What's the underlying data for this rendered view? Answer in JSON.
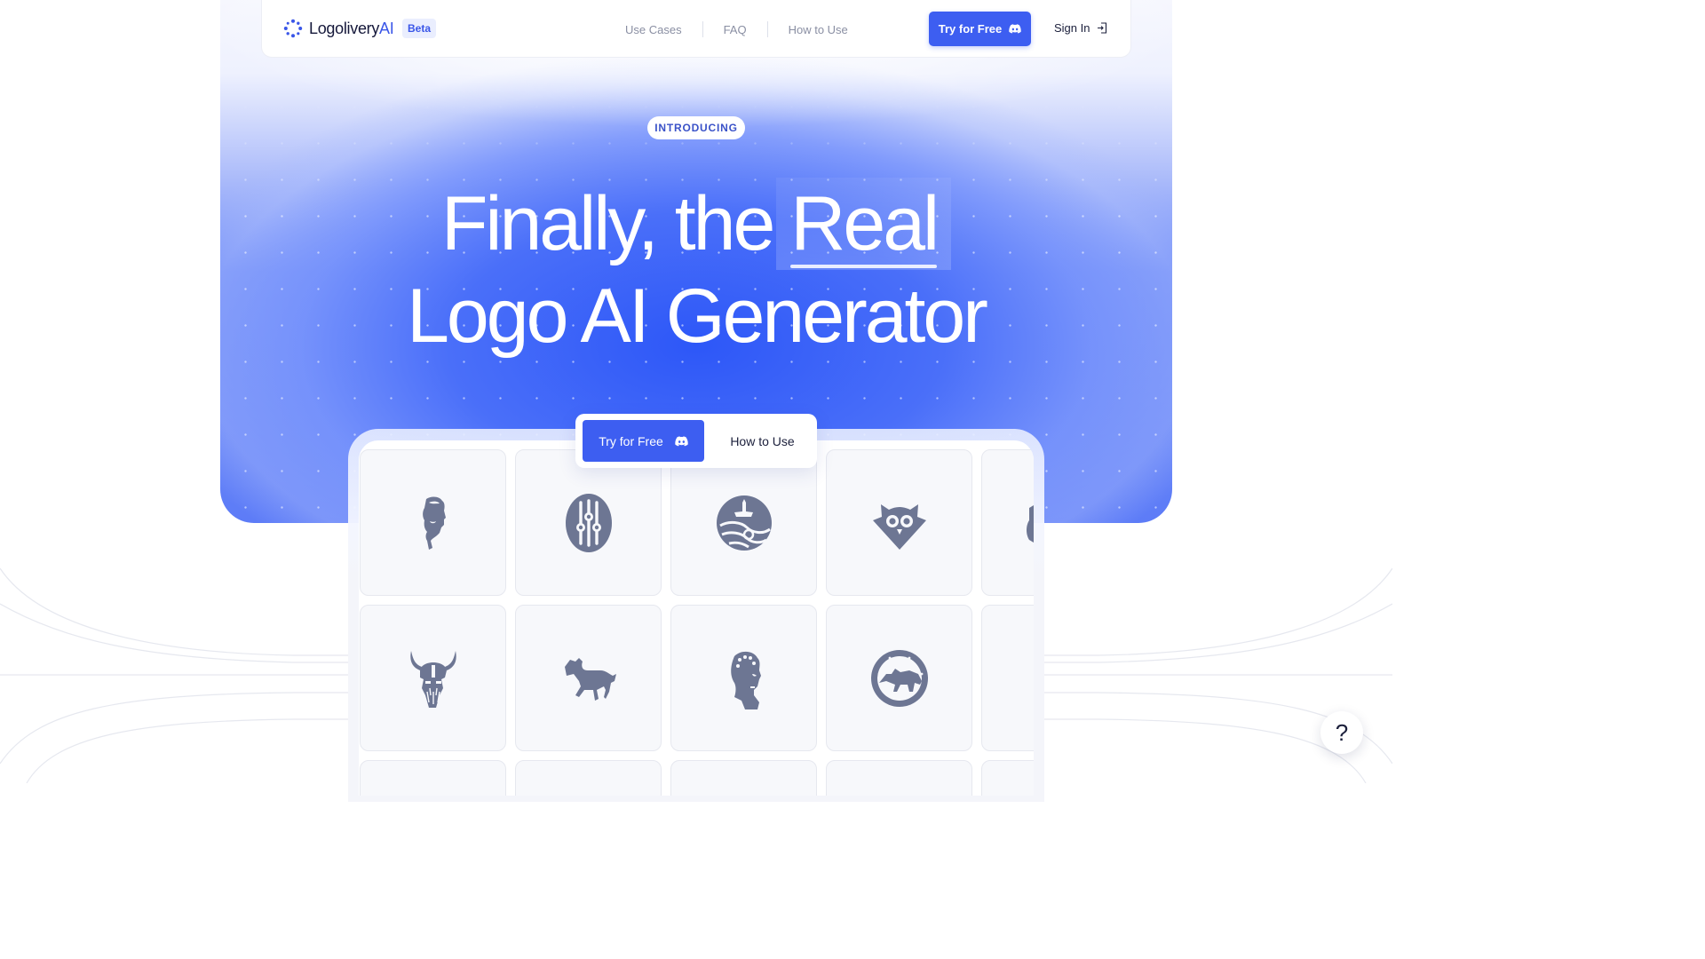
{
  "brand": {
    "name_main": "Logolivery",
    "name_accent": "AI",
    "badge": "Beta"
  },
  "nav": {
    "links": [
      "Use Cases",
      "FAQ",
      "How to Use"
    ],
    "try_label": "Try for Free",
    "signin_label": "Sign In"
  },
  "hero": {
    "pill": "INTRODUCING",
    "title_part1": "Finally, the",
    "title_highlight": "Real",
    "title_line2": "Logo AI Generator"
  },
  "cta": {
    "try_label": "Try for Free",
    "how_label": "How to Use"
  },
  "gallery": {
    "tiles": [
      "man-portrait-logo",
      "tuning-knobs-logo",
      "ship-wave-logo",
      "owl-shield-logo",
      "partial-logo",
      "viking-helmet-logo",
      "horse-logo",
      "greek-bust-logo",
      "dog-circle-logo",
      "partial-logo-2"
    ]
  },
  "help": {
    "label": "?"
  },
  "colors": {
    "accent": "#3d5ef1",
    "logo_gray": "#6d7693",
    "hero_blue": "#2d57f8"
  }
}
